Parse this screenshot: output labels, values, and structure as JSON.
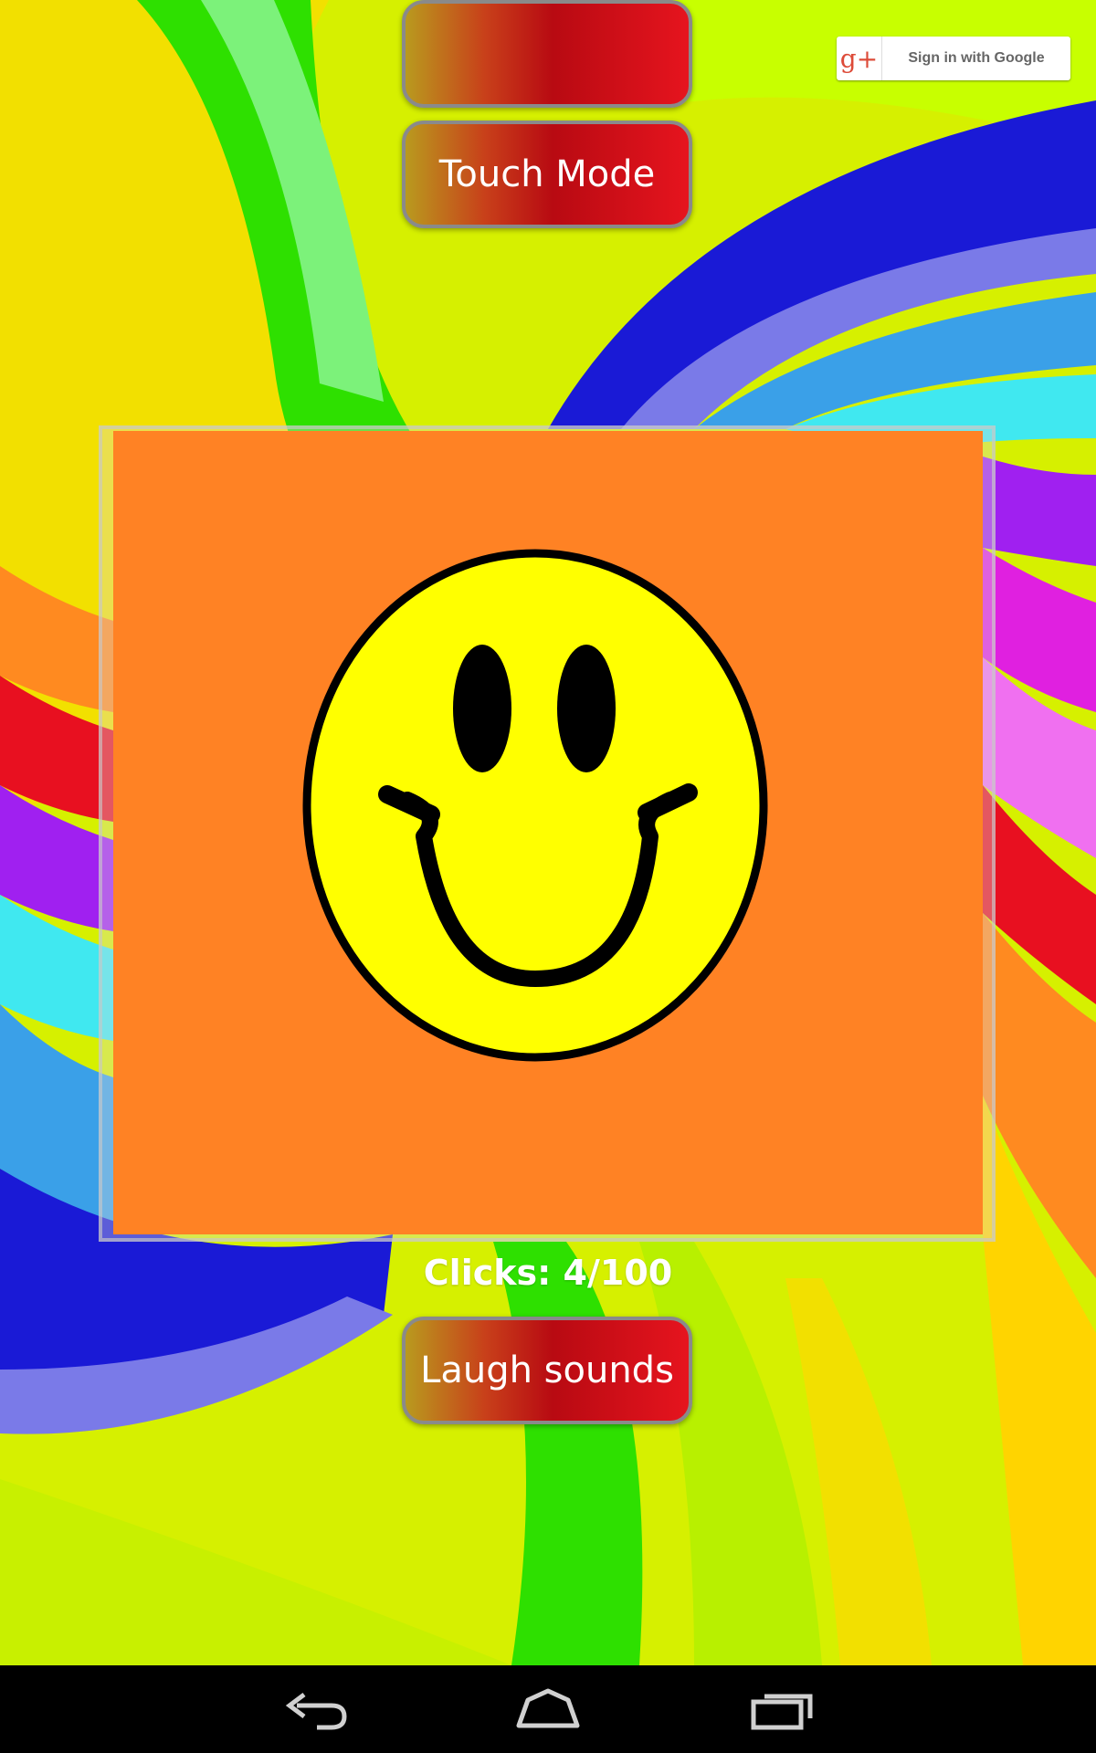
{
  "signin": {
    "label": "Sign in with Google",
    "icon": "g+"
  },
  "buttons": {
    "touch_mode": "Touch Mode",
    "laugh_sounds": "Laugh sounds"
  },
  "counter": {
    "text": "Clicks: 4/100"
  },
  "colors": {
    "panel": "#ff8224",
    "face": "#ffff00",
    "button_red": "#e6141e"
  },
  "nav": {
    "back_icon": "back-icon",
    "home_icon": "home-icon",
    "recents_icon": "recent-apps-icon"
  }
}
